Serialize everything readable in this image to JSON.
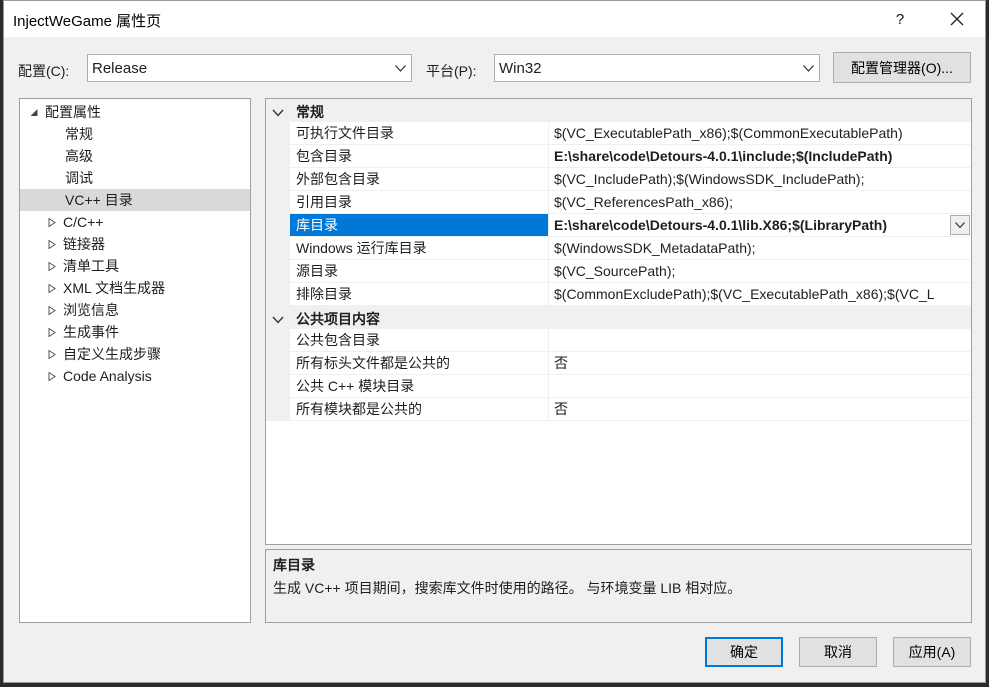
{
  "window": {
    "title": "InjectWeGame 属性页",
    "help_label": "?"
  },
  "toolbar": {
    "config_label": "配置(C):",
    "config_value": "Release",
    "platform_label": "平台(P):",
    "platform_value": "Win32",
    "config_manager_label": "配置管理器(O)..."
  },
  "tree": {
    "items": [
      {
        "label": "配置属性",
        "expander": "expanded"
      },
      {
        "label": "常规",
        "expander": "none"
      },
      {
        "label": "高级",
        "expander": "none"
      },
      {
        "label": "调试",
        "expander": "none"
      },
      {
        "label": "VC++ 目录",
        "expander": "none",
        "selected": true
      },
      {
        "label": "C/C++",
        "expander": "collapsed"
      },
      {
        "label": "链接器",
        "expander": "collapsed"
      },
      {
        "label": "清单工具",
        "expander": "collapsed"
      },
      {
        "label": "XML 文档生成器",
        "expander": "collapsed"
      },
      {
        "label": "浏览信息",
        "expander": "collapsed"
      },
      {
        "label": "生成事件",
        "expander": "collapsed"
      },
      {
        "label": "自定义生成步骤",
        "expander": "collapsed"
      },
      {
        "label": "Code Analysis",
        "expander": "collapsed"
      }
    ]
  },
  "grid": {
    "categories": [
      {
        "name": "常规",
        "properties": [
          {
            "name": "可执行文件目录",
            "value": "$(VC_ExecutablePath_x86);$(CommonExecutablePath)"
          },
          {
            "name": "包含目录",
            "value": "E:\\share\\code\\Detours-4.0.1\\include;$(IncludePath)",
            "bold": true
          },
          {
            "name": "外部包含目录",
            "value": "$(VC_IncludePath);$(WindowsSDK_IncludePath);"
          },
          {
            "name": "引用目录",
            "value": "$(VC_ReferencesPath_x86);"
          },
          {
            "name": "库目录",
            "value": "E:\\share\\code\\Detours-4.0.1\\lib.X86;$(LibraryPath)",
            "bold": true,
            "selected": true
          },
          {
            "name": "Windows 运行库目录",
            "value": "$(WindowsSDK_MetadataPath);"
          },
          {
            "name": "源目录",
            "value": "$(VC_SourcePath);"
          },
          {
            "name": "排除目录",
            "value": "$(CommonExcludePath);$(VC_ExecutablePath_x86);$(VC_L"
          }
        ]
      },
      {
        "name": "公共项目内容",
        "properties": [
          {
            "name": "公共包含目录",
            "value": ""
          },
          {
            "name": "所有标头文件都是公共的",
            "value": "否"
          },
          {
            "name": "公共 C++ 模块目录",
            "value": ""
          },
          {
            "name": "所有模块都是公共的",
            "value": "否"
          }
        ]
      }
    ]
  },
  "description": {
    "title": "库目录",
    "text": "生成 VC++ 项目期间，搜索库文件时使用的路径。 与环境变量 LIB 相对应。"
  },
  "buttons": {
    "ok": "确定",
    "cancel": "取消",
    "apply": "应用(A)"
  },
  "colors": {
    "accent": "#0078d7",
    "dialog_bg": "#f0f0f0",
    "tree_selected": "#cce4f7"
  }
}
